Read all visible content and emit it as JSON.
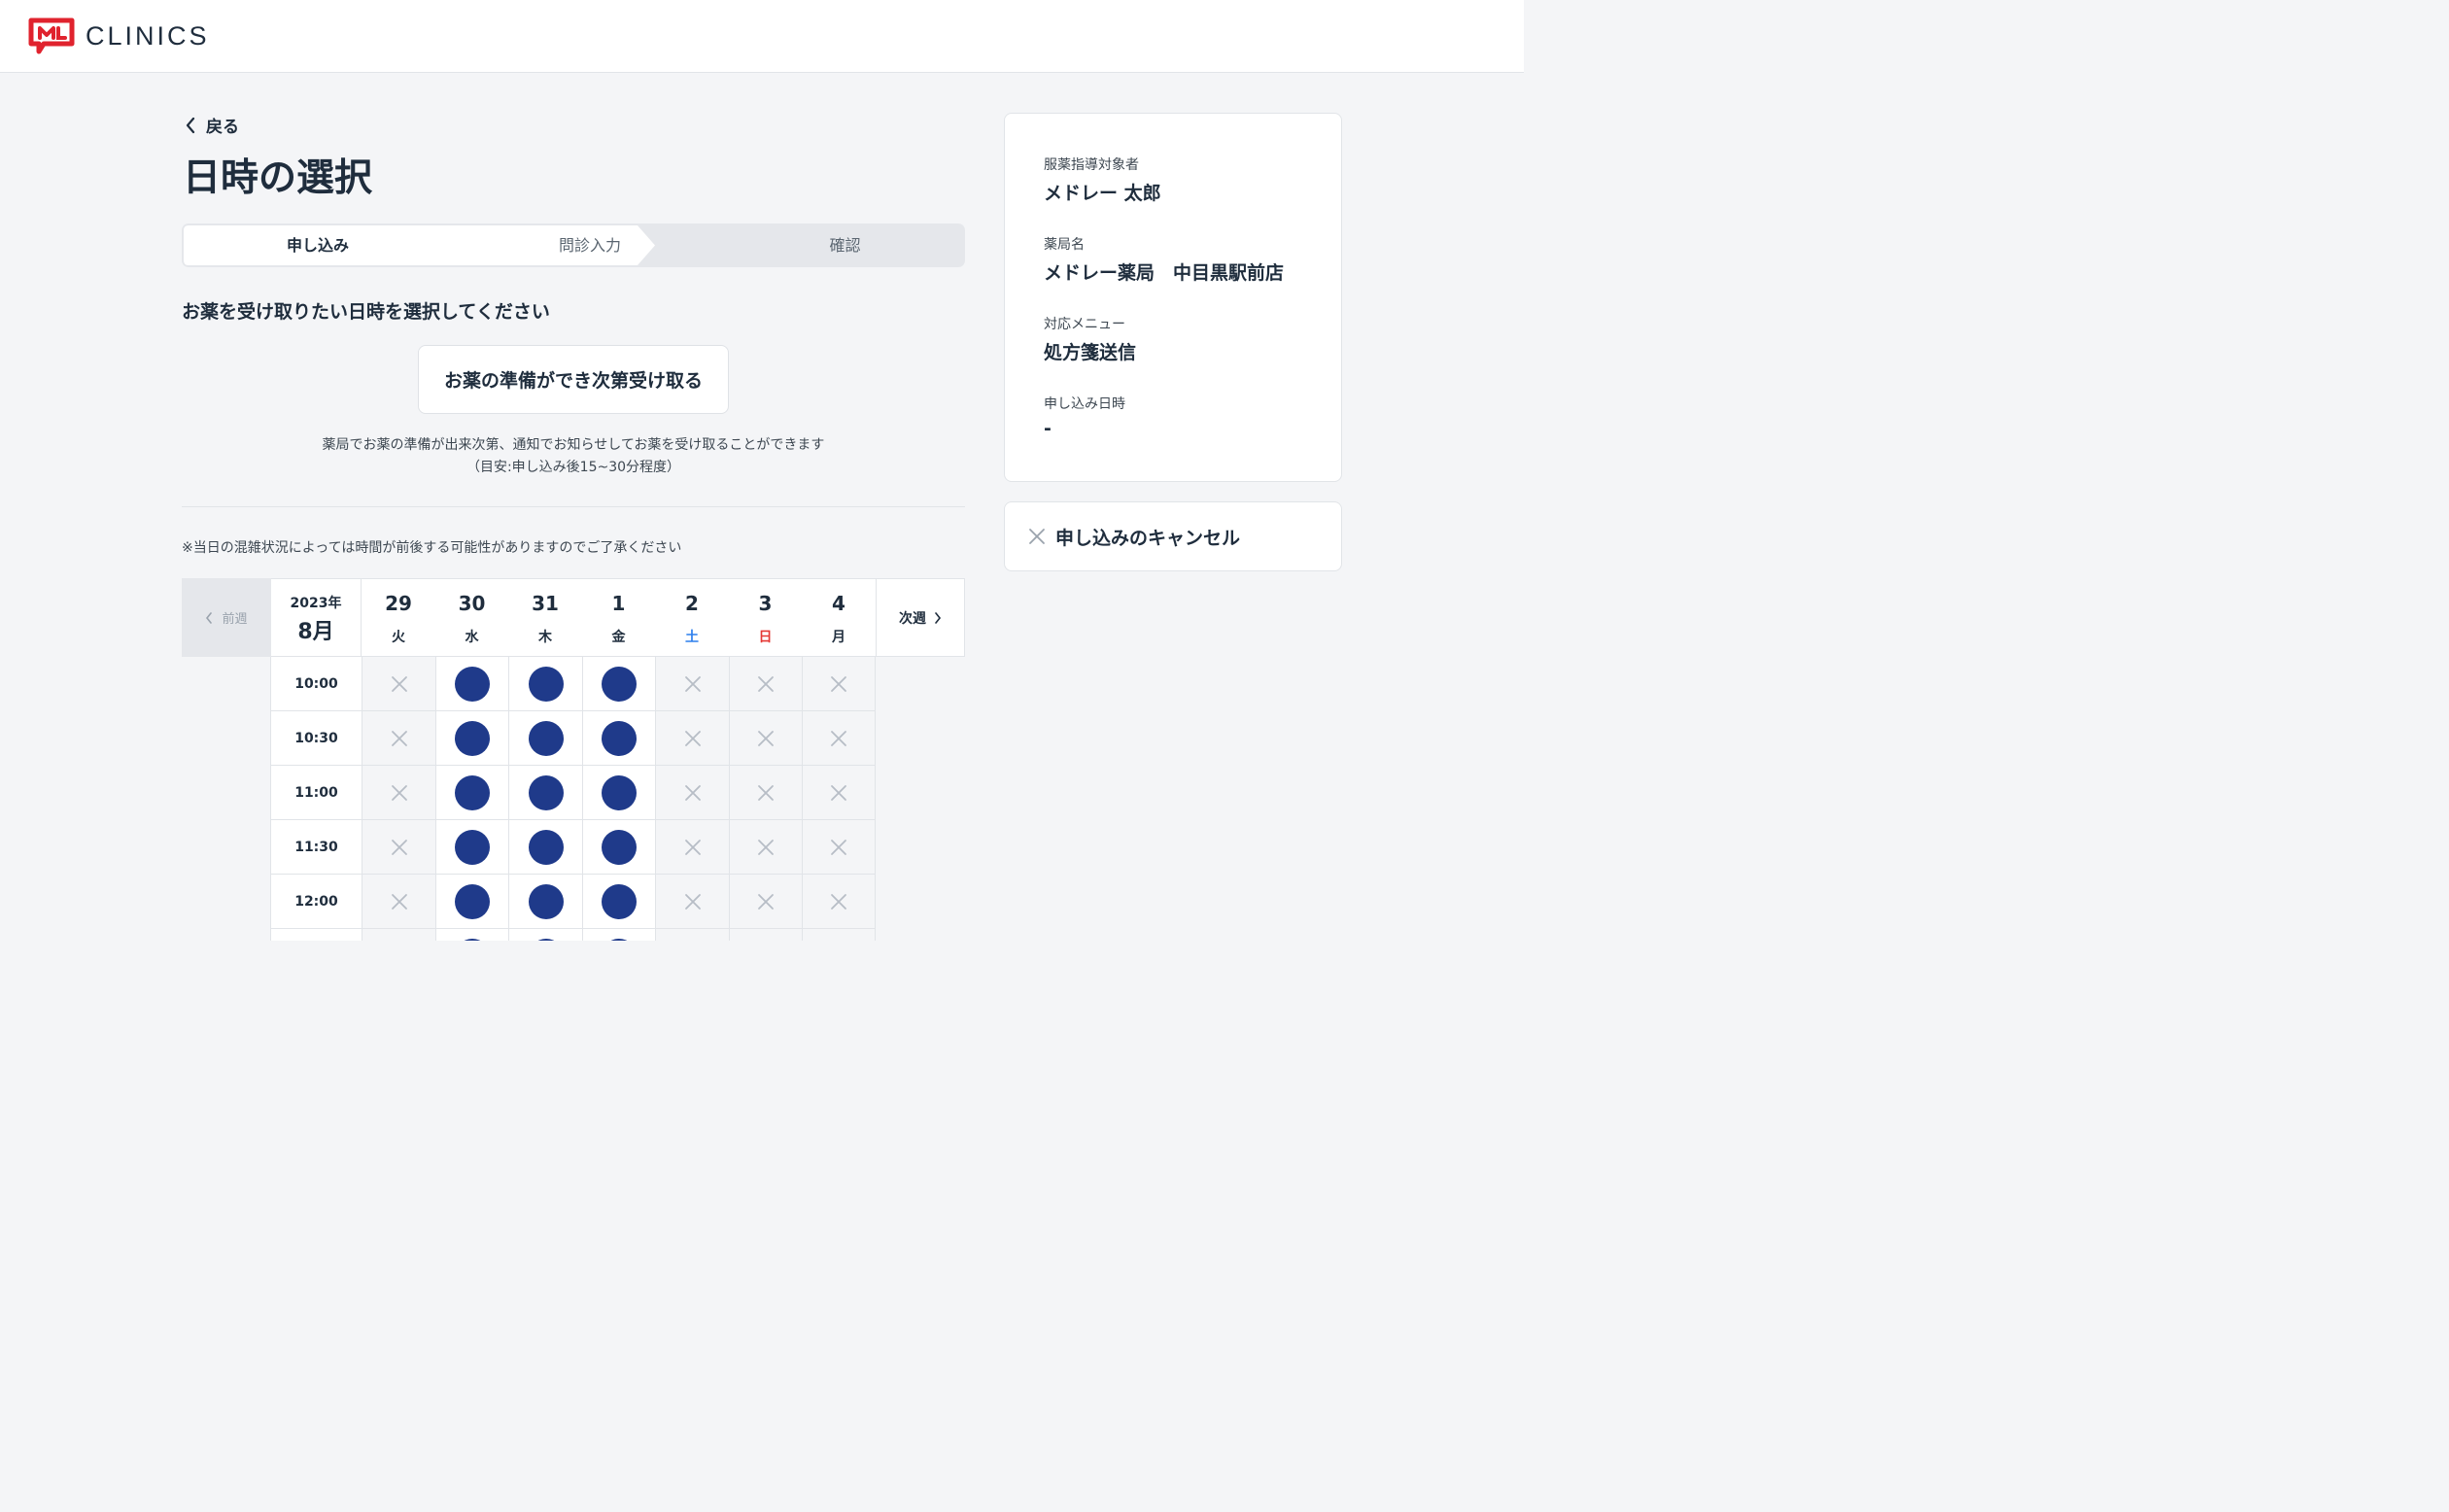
{
  "header": {
    "logo_text": "CLINICS",
    "brand_color": "#e0232e"
  },
  "nav": {
    "back_label": "戻る"
  },
  "page": {
    "title": "日時の選択"
  },
  "steps": [
    {
      "label": "申し込み",
      "active": true
    },
    {
      "label": "問診入力",
      "active": false
    },
    {
      "label": "確認",
      "active": false
    }
  ],
  "instruction": "お薬を受け取りたい日時を選択してください",
  "asap": {
    "button_label": "お薬の準備ができ次第受け取る",
    "description_line1": "薬局でお薬の準備が出来次第、通知でお知らせしてお薬を受け取ることができます",
    "description_line2": "（目安:申し込み後15~30分程度）"
  },
  "note": "※当日の混雑状況によっては時間が前後する可能性がありますのでご了承ください",
  "calendar": {
    "prev_label": "前週",
    "next_label": "次週",
    "year_label": "2023年",
    "month_label": "8月",
    "days": [
      {
        "date": "29",
        "weekday": "火",
        "kind": "weekday"
      },
      {
        "date": "30",
        "weekday": "水",
        "kind": "weekday"
      },
      {
        "date": "31",
        "weekday": "木",
        "kind": "weekday"
      },
      {
        "date": "1",
        "weekday": "金",
        "kind": "weekday"
      },
      {
        "date": "2",
        "weekday": "土",
        "kind": "sat"
      },
      {
        "date": "3",
        "weekday": "日",
        "kind": "sun"
      },
      {
        "date": "4",
        "weekday": "月",
        "kind": "weekday"
      }
    ],
    "slots": [
      {
        "time": "10:00",
        "available": [
          false,
          true,
          true,
          true,
          false,
          false,
          false
        ]
      },
      {
        "time": "10:30",
        "available": [
          false,
          true,
          true,
          true,
          false,
          false,
          false
        ]
      },
      {
        "time": "11:00",
        "available": [
          false,
          true,
          true,
          true,
          false,
          false,
          false
        ]
      },
      {
        "time": "11:30",
        "available": [
          false,
          true,
          true,
          true,
          false,
          false,
          false
        ]
      },
      {
        "time": "12:00",
        "available": [
          false,
          true,
          true,
          true,
          false,
          false,
          false
        ]
      },
      {
        "time": "",
        "available": [
          false,
          true,
          true,
          true,
          false,
          false,
          false
        ]
      }
    ],
    "colors": {
      "available_dot": "#1f3a8a",
      "saturday": "#2f80ed",
      "sunday": "#e53935",
      "unavailable_mark": "#b7bdc6"
    }
  },
  "summary": {
    "patient_label": "服薬指導対象者",
    "patient_value": "メドレー 太郎",
    "pharmacy_label": "薬局名",
    "pharmacy_value": "メドレー薬局　中目黒駅前店",
    "menu_label": "対応メニュー",
    "menu_value": "処方箋送信",
    "datetime_label": "申し込み日時",
    "datetime_value": "-"
  },
  "cancel": {
    "label": "申し込みのキャンセル"
  }
}
